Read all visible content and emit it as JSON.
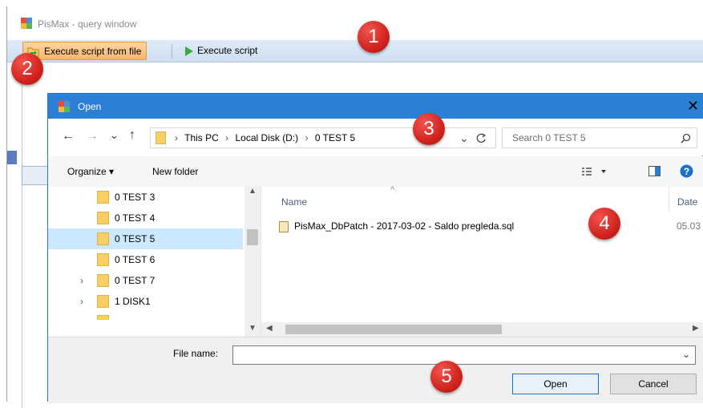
{
  "app": {
    "title": "PisMax - query window",
    "toolbar": {
      "execute_file_label": "Execute script from file",
      "execute_label": "Execute script"
    }
  },
  "dialog": {
    "title": "Open",
    "close_glyph": "✕",
    "nav": {
      "back": "←",
      "forward": "→",
      "recent": "⌄",
      "up": "↑"
    },
    "breadcrumb": [
      "This PC",
      "Local Disk (D:)",
      "0 TEST 5"
    ],
    "breadcrumb_sep": "›",
    "search_placeholder": "Search 0 TEST 5",
    "organize_label": "Organize ▾",
    "new_folder_label": "New folder",
    "tree": [
      {
        "label": "0 TEST 3",
        "expandable": false,
        "selected": false
      },
      {
        "label": "0 TEST 4",
        "expandable": false,
        "selected": false
      },
      {
        "label": "0 TEST 5",
        "expandable": false,
        "selected": true
      },
      {
        "label": "0 TEST 6",
        "expandable": false,
        "selected": false
      },
      {
        "label": "0 TEST 7",
        "expandable": true,
        "selected": false
      },
      {
        "label": "1 DISK1",
        "expandable": true,
        "selected": false
      }
    ],
    "columns": {
      "name": "Name",
      "date": "Date"
    },
    "files": [
      {
        "name": "PisMax_DbPatch - 2017-03-02 -  Saldo pregleda.sql",
        "date": "05.03"
      }
    ],
    "file_name_label": "File name:",
    "file_name_value": "",
    "open_label": "Open",
    "cancel_label": "Cancel"
  },
  "markers": [
    "1",
    "2",
    "3",
    "4",
    "5"
  ],
  "colors": {
    "title_bar": "#2b7fd4",
    "marker": "#d2231e",
    "selected_row": "#cce8ff",
    "exec_file_button": "#f7b56a"
  },
  "icons": [
    "app-icon",
    "folder-open-icon",
    "play-icon",
    "folder-icon",
    "sql-file-icon",
    "refresh-icon",
    "search-icon",
    "view-options-icon",
    "preview-pane-icon",
    "help-icon"
  ]
}
